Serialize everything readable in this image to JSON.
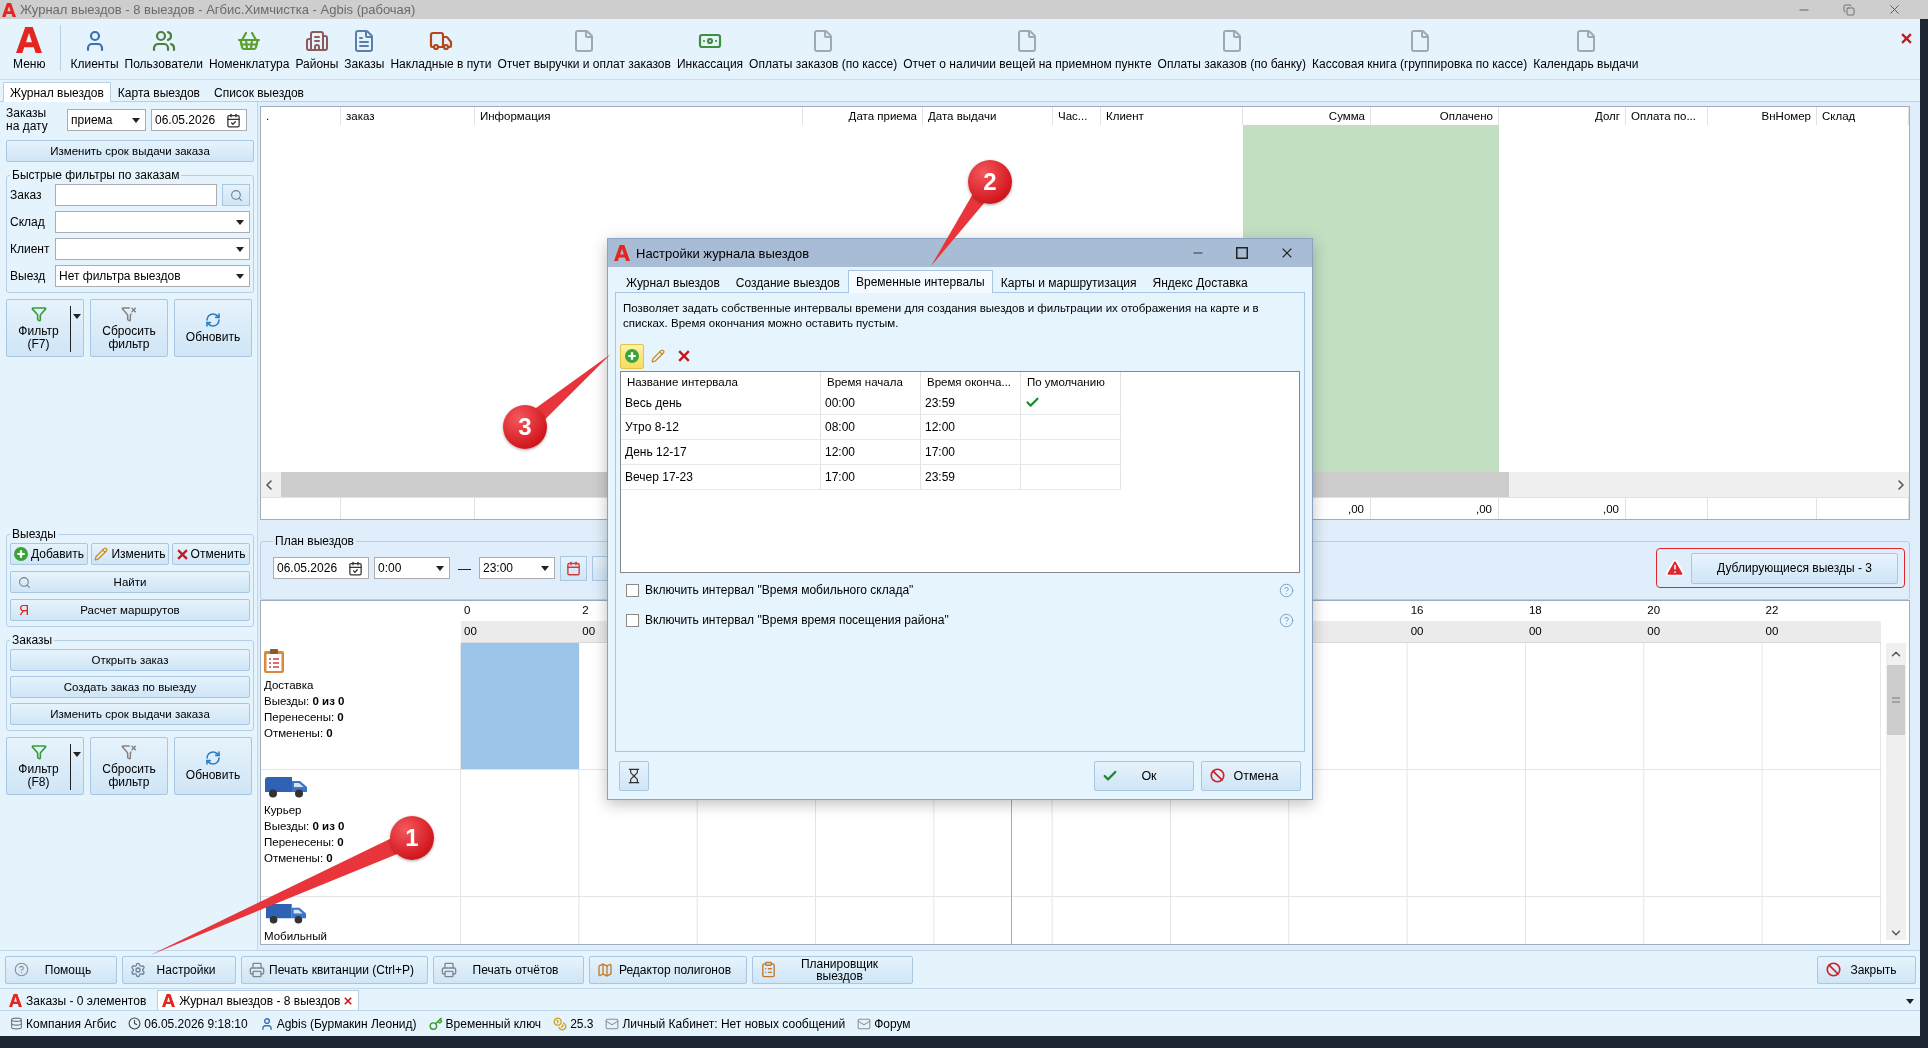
{
  "window": {
    "title": "Журнал выездов - 8 выездов - Агбис.Химчистка - Agbis (рабочая)"
  },
  "ribbon": {
    "items": [
      {
        "kind": "logo",
        "label": "Меню"
      },
      {
        "kind": "person",
        "label": "Клиенты"
      },
      {
        "kind": "people",
        "label": "Пользователи"
      },
      {
        "kind": "basket",
        "label": "Номенклатура"
      },
      {
        "kind": "buildings",
        "label": "Районы"
      },
      {
        "kind": "document",
        "label": "Заказы"
      },
      {
        "kind": "truck",
        "label": "Накладные в пути"
      },
      {
        "kind": "page",
        "label": "Отчет выручки и оплат заказов"
      },
      {
        "kind": "cash",
        "label": "Инкассация"
      },
      {
        "kind": "page",
        "label": "Оплаты заказов (по кассе)"
      },
      {
        "kind": "page",
        "label": "Отчет о наличии вещей на приемном пункте"
      },
      {
        "kind": "page",
        "label": "Оплаты заказов (по банку)"
      },
      {
        "kind": "page",
        "label": "Кассовая книга (группировка по кассе)"
      },
      {
        "kind": "page",
        "label": "Календарь выдачи"
      }
    ]
  },
  "tabs": [
    {
      "label": "Журнал выездов",
      "selected": true
    },
    {
      "label": "Карта выездов",
      "selected": false
    },
    {
      "label": "Список выездов",
      "selected": false
    }
  ],
  "left_panel": {
    "date_filter": {
      "label": "Заказы на дату",
      "mode": "приема",
      "date": "06.05.2026"
    },
    "change_due_button": "Изменить срок выдачи заказа",
    "quick_filters": {
      "title": "Быстрые фильтры по заказам",
      "fields": [
        {
          "kind": "search",
          "label": "Заказ"
        },
        {
          "kind": "dropdown",
          "label": "Склад"
        },
        {
          "kind": "dropdown",
          "label": "Клиент"
        },
        {
          "kind": "dropdown",
          "label": "Выезд",
          "value": "Нет фильтра выездов"
        }
      ]
    },
    "filter_buttons": [
      {
        "kind": "filter",
        "label": "Фильтр (F7)"
      },
      {
        "kind": "reset",
        "label": "Сбросить фильтр"
      },
      {
        "kind": "refresh",
        "label": "Обновить"
      }
    ],
    "trips": {
      "title": "Выезды",
      "actions": [
        {
          "kind": "add",
          "label": "Добавить"
        },
        {
          "kind": "edit",
          "label": "Изменить"
        },
        {
          "kind": "cancel",
          "label": "Отменить"
        }
      ],
      "buttons": [
        {
          "kind": "search",
          "label": "Найти"
        },
        {
          "kind": "route",
          "icon": "Я",
          "label": "Расчет маршрутов"
        }
      ]
    },
    "orders": {
      "title": "Заказы",
      "buttons": [
        "Открыть заказ",
        "Создать заказ по выезду",
        "Изменить срок выдачи заказа"
      ]
    },
    "order_filter_buttons": [
      {
        "kind": "filter",
        "label": "Фильтр (F8)"
      },
      {
        "kind": "reset",
        "label": "Сбросить фильтр"
      },
      {
        "kind": "refresh",
        "label": "Обновить"
      }
    ]
  },
  "grid": {
    "columns": [
      {
        "label": "."
      },
      {
        "label": "заказ"
      },
      {
        "label": "Информация"
      },
      {
        "label": "Дата приема"
      },
      {
        "label": "Дата выдачи"
      },
      {
        "label": "Час..."
      },
      {
        "label": "Клиент"
      },
      {
        "label": "Сумма",
        "highlighted": true,
        "total": ",00"
      },
      {
        "label": "Оплачено",
        "highlighted": true,
        "total": ",00"
      },
      {
        "label": "Долг",
        "total": ",00"
      },
      {
        "label": "Оплата по..."
      },
      {
        "label": "ВнНомер"
      },
      {
        "label": "Склад"
      }
    ]
  },
  "plan": {
    "title": "План выездов",
    "date": "06.05.2026",
    "time_from": "0:00",
    "dash": "—",
    "time_to": "23:00",
    "duplicates_button": "Дублирующиеся выезды - 3"
  },
  "timeline": {
    "scale_start": [
      {
        "hour": "0",
        "minutes": "00"
      },
      {
        "hour": "2",
        "minutes": "00"
      }
    ],
    "scale_end": [
      {
        "hour": "16",
        "minutes": "00"
      },
      {
        "hour": "18",
        "minutes": "00"
      },
      {
        "hour": "20",
        "minutes": "00"
      },
      {
        "hour": "22",
        "minutes": "00"
      }
    ],
    "current_time": {
      "level": 0.3876
    },
    "rows": [
      {
        "kind": "clipboard",
        "name": "Доставка",
        "selected": true,
        "stats": [
          "Выезды: **0 из 0**",
          "Перенесены: **0**",
          "Отменены: **0**"
        ]
      },
      {
        "kind": "van",
        "name": "Курьер",
        "selected": false,
        "stats": [
          "Выезды: **0 из 0**",
          "Перенесены: **0**",
          "Отменены: **0**"
        ]
      },
      {
        "kind": "van",
        "name": "Мобильный",
        "selected": false
      }
    ]
  },
  "dialog": {
    "title": "Настройки журнала выездов",
    "tabs": [
      {
        "label": "Журнал выездов",
        "selected": false
      },
      {
        "label": "Создание выездов",
        "selected": false
      },
      {
        "label": "Временные интервалы",
        "selected": true
      },
      {
        "label": "Карты и маршрутизация",
        "selected": false
      },
      {
        "label": "Яндекс Доставка",
        "selected": false
      }
    ],
    "description": "Позволяет задать собственные интервалы времени для создания выездов и фильтрации их отображения на карте и в списках. Время окончания можно оставить пустым.",
    "toolbar": [
      {
        "kind": "add",
        "hovered": true
      },
      {
        "kind": "edit",
        "hovered": false
      },
      {
        "kind": "delete",
        "hovered": false
      }
    ],
    "table": {
      "columns": [
        "Название интервала",
        "Время начала",
        "Время оконча...",
        "По умолчанию"
      ],
      "rows": [
        {
          "name": "Весь день",
          "start": "00:00",
          "end": "23:59",
          "default": true
        },
        {
          "name": "Утро 8-12",
          "start": "08:00",
          "end": "12:00",
          "default": false
        },
        {
          "name": "День 12-17",
          "start": "12:00",
          "end": "17:00",
          "default": false
        },
        {
          "name": "Вечер 17-23",
          "start": "17:00",
          "end": "23:59",
          "default": false
        }
      ]
    },
    "options": [
      {
        "label": "Включить интервал \"Время мобильного склада\"",
        "checked": false
      },
      {
        "label": "Включить интервал \"Время время посещения района\"",
        "checked": false
      }
    ],
    "buttons": [
      {
        "kind": "ok",
        "label": "Ок"
      },
      {
        "kind": "cancel",
        "label": "Отмена"
      }
    ]
  },
  "bottom_bar": {
    "buttons": [
      {
        "kind": "help",
        "label": "Помощь"
      },
      {
        "kind": "settings",
        "label": "Настройки"
      },
      {
        "kind": "print",
        "label": "Печать квитанции (Ctrl+P)"
      },
      {
        "kind": "print",
        "label": "Печать отчётов"
      },
      {
        "kind": "map",
        "label": "Редактор полигонов"
      },
      {
        "kind": "planner",
        "label": "Планировщик выездов"
      }
    ],
    "close_button": {
      "kind": "close",
      "label": "Закрыть"
    }
  },
  "document_tabs": [
    {
      "label": "Заказы - 0 элементов",
      "selected": false,
      "closable": false
    },
    {
      "label": "Журнал выездов - 8 выездов",
      "selected": true,
      "closable": true
    }
  ],
  "status_bar": [
    {
      "kind": "company",
      "text": "Компания Агбис"
    },
    {
      "kind": "clock",
      "text": "06.05.2026 9:18:10"
    },
    {
      "kind": "user",
      "text": "Agbis (Бурмакин Леонид)"
    },
    {
      "kind": "key",
      "text": "Временный ключ"
    },
    {
      "kind": "coin",
      "text": "25.3"
    },
    {
      "kind": "mail",
      "text": "Личный Кабинет: Нет новых сообщений"
    },
    {
      "kind": "mail",
      "text": "Форум"
    }
  ],
  "callouts": [
    {
      "number": "1"
    },
    {
      "number": "2"
    },
    {
      "number": "3"
    }
  ]
}
